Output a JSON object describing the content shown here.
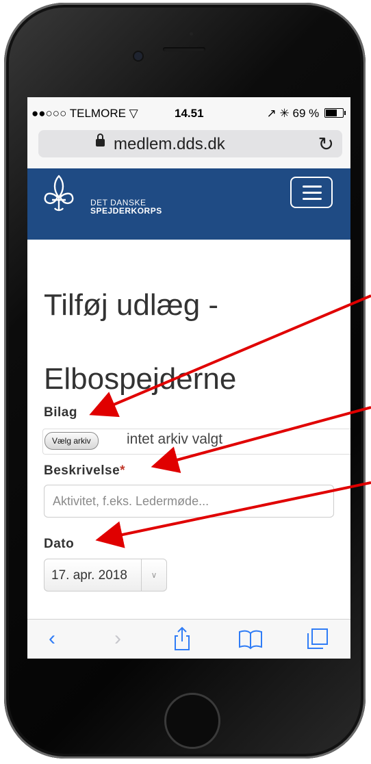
{
  "status_bar": {
    "carrier": "●●○○○ TELMORE",
    "time": "14.51",
    "battery": "69 %",
    "icons": [
      "wifi-icon",
      "location-icon",
      "bluetooth-icon",
      "battery-icon"
    ]
  },
  "browser": {
    "url": "medlem.dds.dk",
    "icons": [
      "lock-icon",
      "reload-icon"
    ]
  },
  "navbar": {
    "brand_line1": "DET DANSKE",
    "brand_line2": "SPEJDERKORPS",
    "background": "#1f4b84"
  },
  "page": {
    "title": "Tilføj udlæg - Elbospejderne"
  },
  "form": {
    "attachment_label": "Bilag",
    "file_button_label": "Vælg arkiv",
    "file_status": "intet arkiv valgt",
    "description_label": "Beskrivelse",
    "required_marker": "*",
    "description_placeholder": "Aktivitet, f.eks. Ledermøde...",
    "date_label": "Dato",
    "date_value": "17. apr. 2018"
  },
  "toolbar": {
    "icons": [
      "back-icon",
      "forward-icon",
      "share-icon",
      "bookmarks-icon",
      "tabs-icon"
    ],
    "accent": "#2f7cf6"
  },
  "annotation_color": "#e00000"
}
